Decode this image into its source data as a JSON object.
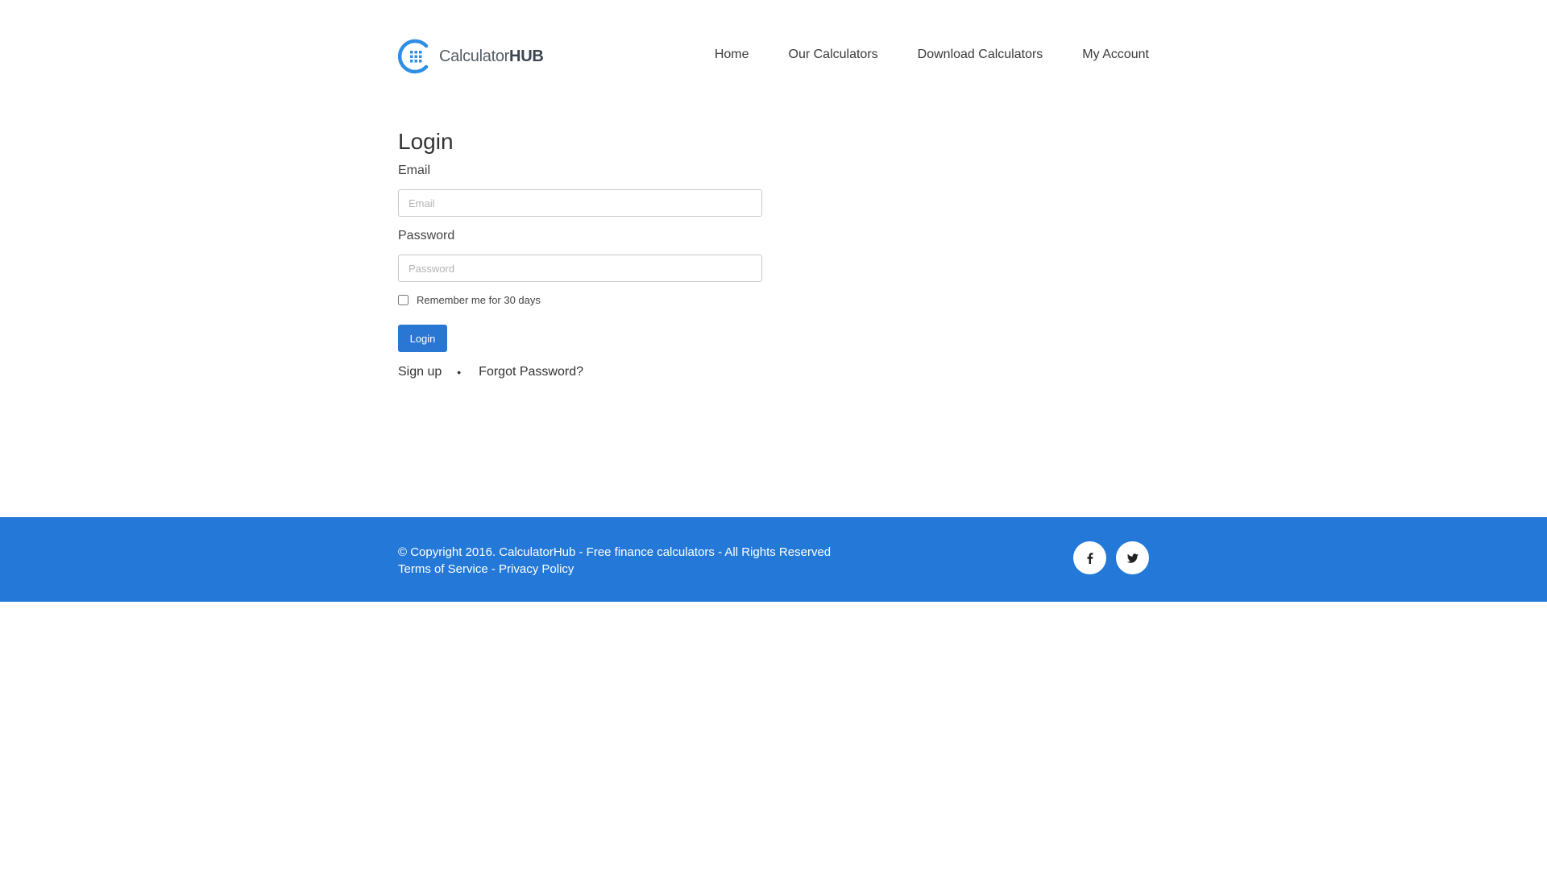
{
  "header": {
    "logo": {
      "text_light": "Calculator",
      "text_bold": "HUB"
    },
    "nav": [
      "Home",
      "Our Calculators",
      "Download Calculators",
      "My Account"
    ]
  },
  "login": {
    "title": "Login",
    "email_label": "Email",
    "email_placeholder": "Email",
    "email_value": "",
    "password_label": "Password",
    "password_placeholder": "Password",
    "password_value": "",
    "remember_label": "Remember me for 30 days",
    "remember_checked": false,
    "button_label": "Login",
    "signup_link": "Sign up",
    "separator": "•",
    "forgot_link": "Forgot Password?"
  },
  "footer": {
    "copyright": "© Copyright 2016. CalculatorHub - Free finance calculators - All Rights Reserved",
    "terms": "Terms of Service",
    "dash": " - ",
    "privacy": "Privacy Policy",
    "social": [
      "facebook-icon",
      "twitter-icon"
    ]
  },
  "colors": {
    "accent": "#2479d8",
    "button": "#2a76d3",
    "logo_blue": "#2e8ee6"
  }
}
